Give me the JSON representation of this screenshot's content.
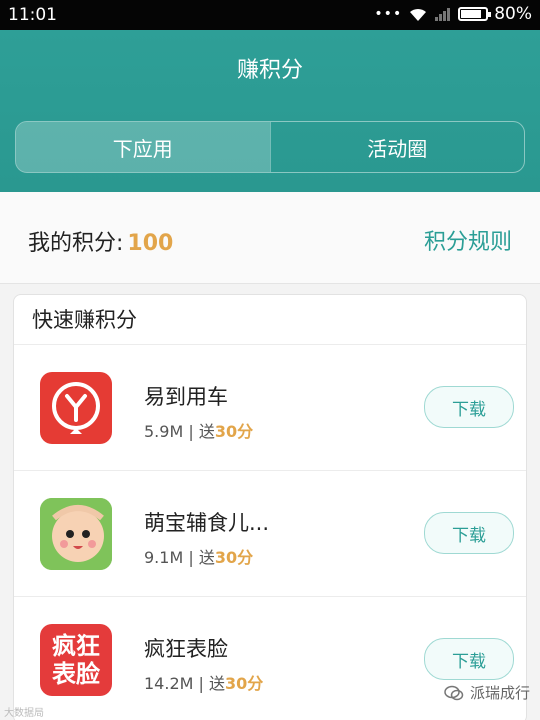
{
  "statusbar": {
    "time": "11:01",
    "dots": "•••",
    "battery": "80%"
  },
  "header": {
    "title": "赚积分"
  },
  "tabs": [
    {
      "label": "下应用",
      "active": true
    },
    {
      "label": "活动圈",
      "active": false
    }
  ],
  "points": {
    "label": "我的积分:",
    "value": "100",
    "rules_link": "积分规则"
  },
  "quick": {
    "title": "快速赚积分",
    "apps": [
      {
        "name": "易到用车",
        "size": "5.9M",
        "separator": "|",
        "reward_prefix": "送",
        "reward_points": "30分",
        "button": "下载",
        "icon": "yidao-app-icon"
      },
      {
        "name": "萌宝辅食儿...",
        "size": "9.1M",
        "separator": "|",
        "reward_prefix": "送",
        "reward_points": "30分",
        "button": "下载",
        "icon": "mengbao-app-icon"
      },
      {
        "name": "疯狂表脸",
        "size": "14.2M",
        "separator": "|",
        "reward_prefix": "送",
        "reward_points": "30分",
        "button": "下载",
        "icon": "fengkuang-app-icon",
        "icon_text": "疯狂表脸"
      }
    ]
  },
  "watermarks": {
    "left": "大数据局",
    "right": "派瑞成行"
  },
  "colors": {
    "header": "#2e9f97",
    "accent": "#2b9e96",
    "points": "#e2a54a"
  }
}
